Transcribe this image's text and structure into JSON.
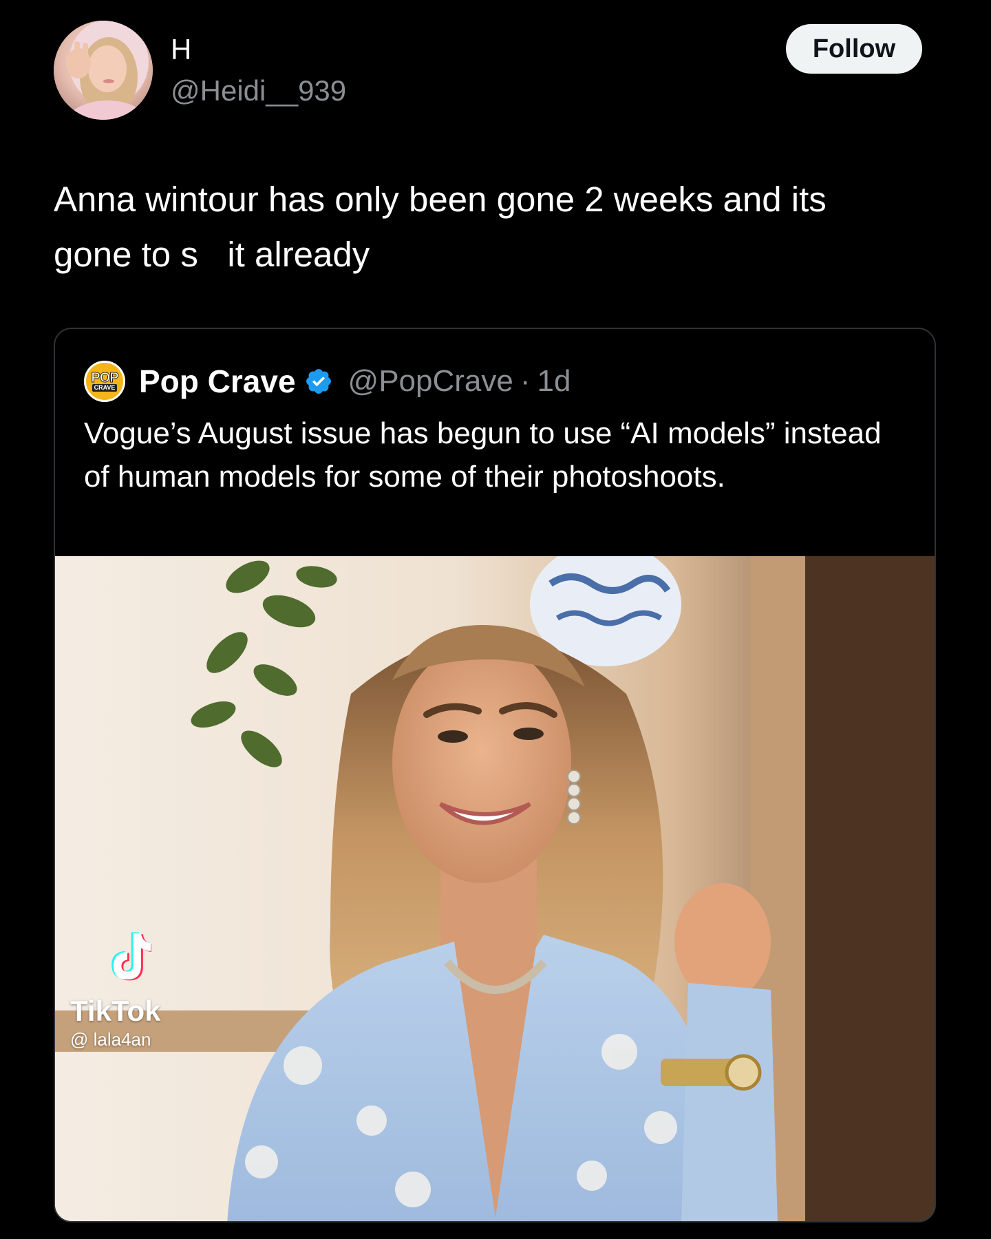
{
  "author": {
    "name": "H",
    "handle": "@Heidi__939",
    "avatar_icon": "profile-photo"
  },
  "follow_button": {
    "label": "Follow"
  },
  "tweet": {
    "text": "Anna wintour has only been gone 2 weeks and its\ngone to s   it already"
  },
  "quoted_tweet": {
    "author_name": "Pop Crave",
    "verified": true,
    "verified_icon": "verified-badge-icon",
    "verified_color": "#1d9bf0",
    "avatar_text_top": "POP",
    "avatar_text_bottom": "CRAVE",
    "handle": "@PopCrave",
    "separator": "·",
    "timestamp": "1d",
    "text": "Vogue’s August issue has begun to use “AI models” instead of human models for some of their photoshoots.",
    "media": {
      "description_icon": "photo-image",
      "watermark": {
        "brand": "TikTok",
        "user": "@ lala4an"
      }
    }
  },
  "colors": {
    "background": "#000000",
    "text_primary": "#ffffff",
    "text_secondary": "#8b8f94",
    "follow_bg": "#eff3f4",
    "border": "#2f3336",
    "popcrave_yellow": "#f4b41a"
  }
}
